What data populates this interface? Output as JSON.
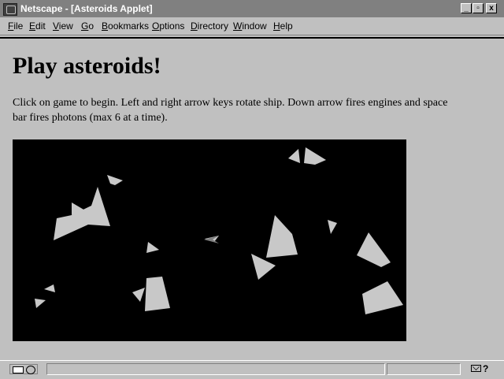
{
  "window": {
    "title": "Netscape - [Asteroids Applet]",
    "controls": [
      "_",
      "▫",
      "x"
    ]
  },
  "menu": [
    {
      "label": "File"
    },
    {
      "label": "Edit"
    },
    {
      "label": "View"
    },
    {
      "label": "Go"
    },
    {
      "label": "Bookmarks"
    },
    {
      "label": "Options"
    },
    {
      "label": "Directory"
    },
    {
      "label": "Window"
    },
    {
      "label": "Help"
    }
  ],
  "page": {
    "title": "Play asteroids!",
    "description": "Click on game to begin. Left and right arrow keys rotate ship. Down arrow fires engines and space bar fires photons (max 6 at a time)."
  },
  "applet": {
    "background": "#000000",
    "asteroid_color": "#c8c8c8",
    "ship_color": "#808080"
  },
  "statusbar": {
    "status_text": "",
    "mail_symbol": "?"
  },
  "icons": {
    "app": "netscape-logo-icon",
    "security": "security-key-icon",
    "mail": "mail-icon"
  }
}
